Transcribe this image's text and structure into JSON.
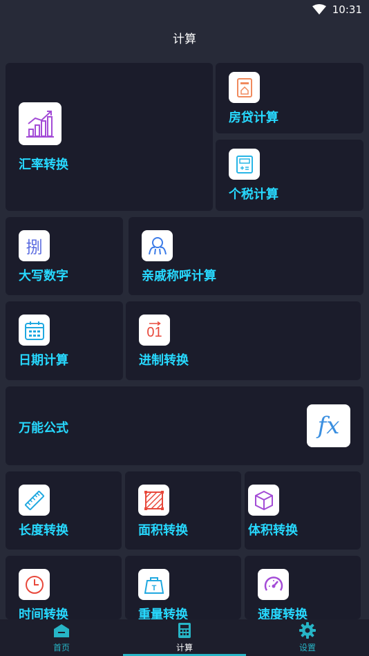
{
  "status": {
    "time": "10:31"
  },
  "header": {
    "title": "计算"
  },
  "cards": {
    "exchange": "汇率转换",
    "mortgage": "房贷计算",
    "tax": "个税计算",
    "uppercase": "大写数字",
    "relatives": "亲戚称呼计算",
    "date": "日期计算",
    "radix": "进制转换",
    "formula": "万能公式",
    "length": "长度转换",
    "area": "面积转换",
    "volume": "体积转换",
    "time": "时间转换",
    "weight": "重量转换",
    "speed": "速度转换"
  },
  "icons": {
    "exchange": "bar-chart-icon",
    "mortgage": "house-icon",
    "tax": "calculator-icon",
    "uppercase": "uppercase-char-icon",
    "uppercase_glyph": "捌",
    "relatives": "people-icon",
    "date": "calendar-icon",
    "radix": "binary-icon",
    "radix_glyph": "01",
    "formula": "fx-icon",
    "formula_glyph": "fx",
    "length": "ruler-icon",
    "area": "area-icon",
    "volume": "cube-icon",
    "time": "clock-icon",
    "weight": "weight-icon",
    "weight_glyph": "T",
    "speed": "speedometer-icon"
  },
  "nav": {
    "home": "首页",
    "calc": "计算",
    "settings": "设置"
  },
  "colors": {
    "background": "#272a38",
    "card": "#1b1c2b",
    "accent": "#27d9ff",
    "nav_accent": "#27b5c6"
  }
}
